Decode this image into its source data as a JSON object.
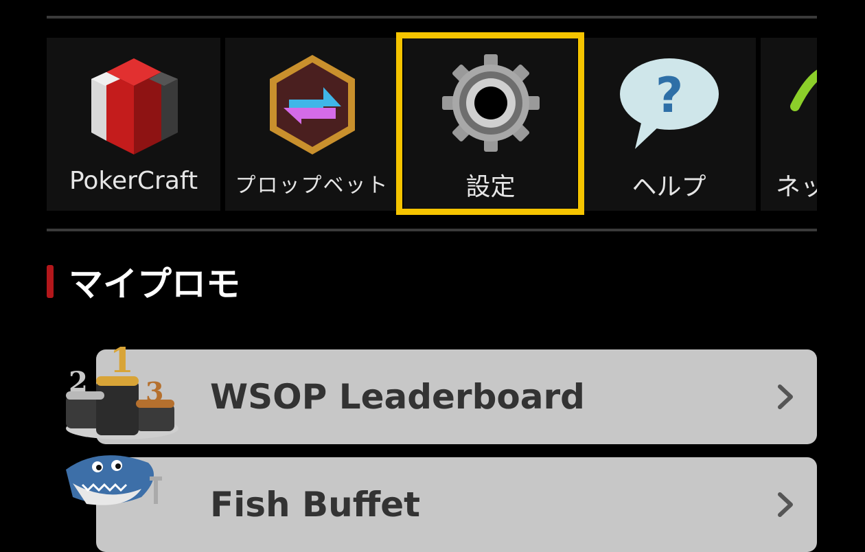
{
  "menu": {
    "items": [
      {
        "label": "PokerCraft",
        "icon": "pokercraft-icon"
      },
      {
        "label": "プロップベット",
        "icon": "propbet-icon"
      },
      {
        "label": "設定",
        "icon": "gear-icon"
      },
      {
        "label": "ヘルプ",
        "icon": "help-icon"
      },
      {
        "label": "ネッ",
        "icon": "network-icon"
      }
    ],
    "highlight_color": "#f5c400"
  },
  "section": {
    "title": "マイプロモ",
    "accent_color": "#b3171b"
  },
  "promos": [
    {
      "label": "WSOP Leaderboard",
      "icon": "podium-icon"
    },
    {
      "label": "Fish Buffet",
      "icon": "shark-icon"
    }
  ]
}
